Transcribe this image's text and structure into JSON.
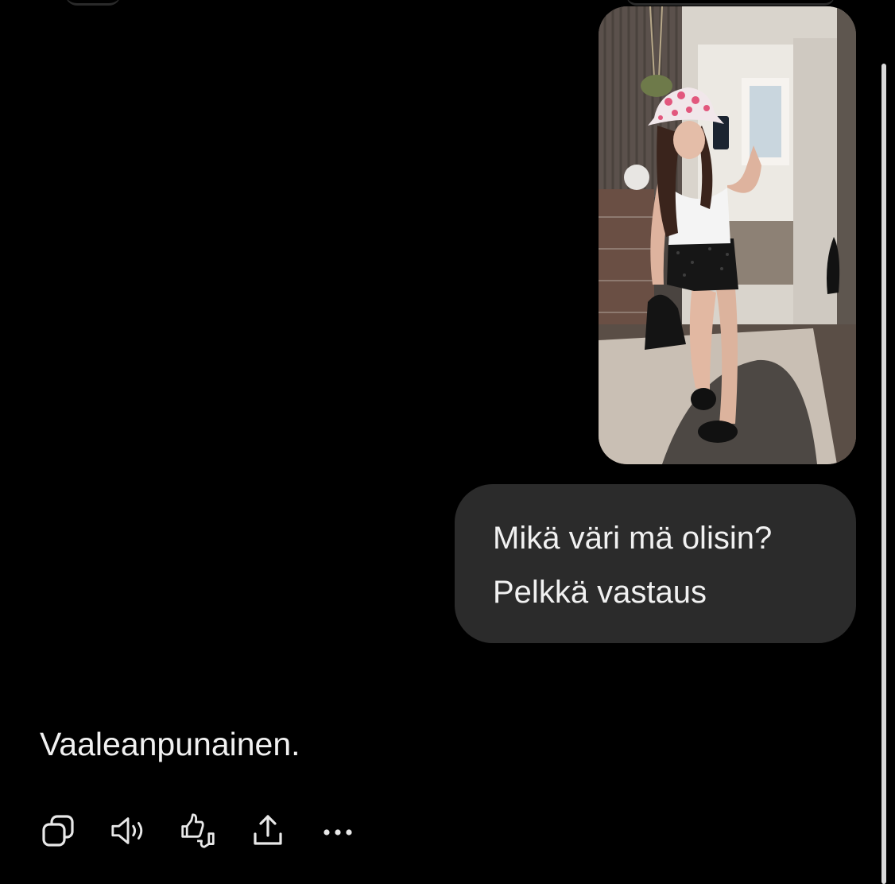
{
  "message": {
    "user": {
      "lines": [
        "Mikä väri mä olisin?",
        "Pelkkä vastaus"
      ]
    },
    "assistant": {
      "text": "Vaaleanpunainen."
    }
  },
  "actions": [
    {
      "icon": "copy-icon"
    },
    {
      "icon": "read-aloud-icon"
    },
    {
      "icon": "feedback-thumbs-icon"
    },
    {
      "icon": "share-icon"
    },
    {
      "icon": "more-icon"
    }
  ],
  "colors": {
    "background": "#000000",
    "bubble": "#2b2b2b",
    "text": "#f1f1f1",
    "icon": "#e8e8e8"
  }
}
